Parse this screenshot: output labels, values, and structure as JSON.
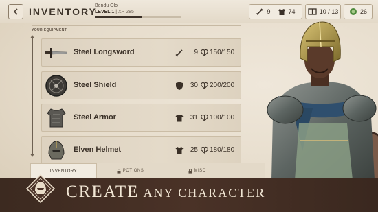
{
  "header": {
    "back_icon": "chevron-left-icon",
    "title": "INVENTORY",
    "character_name": "Bendu Olo",
    "level_label": "LEVEL",
    "level_value": "1",
    "xp_text": "XP 285",
    "xp_progress_fraction": 0.55,
    "counters": {
      "attack": "9",
      "armor": "74",
      "capacity": "10 / 13",
      "gold": "26"
    }
  },
  "equipment": {
    "section_label": "YOUR EQUIPMENT",
    "items": [
      {
        "name": "Steel Longsword",
        "stat_icon": "sword-icon",
        "stat": "9",
        "durability": "150/150"
      },
      {
        "name": "Steel Shield",
        "stat_icon": "shield-icon",
        "stat": "30",
        "durability": "200/200"
      },
      {
        "name": "Steel Armor",
        "stat_icon": "armor-icon",
        "stat": "31",
        "durability": "100/100"
      },
      {
        "name": "Elven Helmet",
        "stat_icon": "armor-icon",
        "stat": "25",
        "durability": "180/180"
      }
    ]
  },
  "tabs": [
    {
      "label": "INVENTORY",
      "locked": false
    },
    {
      "label": "POTIONS",
      "locked": true
    },
    {
      "label": "MISC",
      "locked": true
    }
  ],
  "banner": {
    "text_big": "CREATE",
    "text_small": "ANY CHARACTER"
  },
  "colors": {
    "banner_bg": "#4a3227",
    "parchment": "#e9e0d1",
    "gold_coin": "#4d8a3b"
  }
}
